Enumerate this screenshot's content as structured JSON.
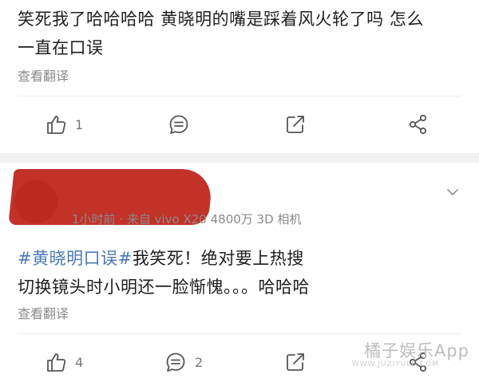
{
  "post1": {
    "line1": "笑死我了哈哈哈哈 黄晓明的嘴是踩着风火轮了吗 怎么",
    "line2": "一直在口误",
    "translate": "查看翻译",
    "actions": {
      "like_count": "1"
    }
  },
  "post2": {
    "meta": "1小时前 · 来自 vivo X20 4800万 3D 相机",
    "hashtag": "#黄晓明口误#",
    "line1_rest": "我笑死！绝对要上热搜",
    "line2": "切换镜头时小明还一脸惭愧。。。哈哈哈",
    "translate": "查看翻译",
    "actions": {
      "like_count": "4",
      "comment_count": "2"
    }
  },
  "watermark": {
    "text": "橘子娱乐App",
    "sub": "WWW.JUZIYULE.COM"
  }
}
